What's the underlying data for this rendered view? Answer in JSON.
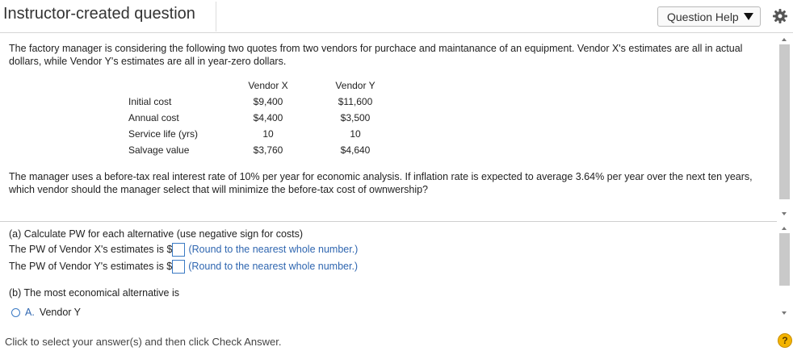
{
  "header": {
    "title": "Instructor-created question",
    "help_button_label": "Question Help"
  },
  "question": {
    "intro": "The factory manager is considering the following two quotes from two vendors for purchace and maintanance of an equipment. Vendor X's estimates are all in actual dollars, while Vendor Y's estimates are all in year-zero dollars.",
    "table": {
      "headers": [
        "Vendor X",
        "Vendor Y"
      ],
      "rows": [
        {
          "label": "Initial cost",
          "x": "$9,400",
          "y": "$11,600"
        },
        {
          "label": "Annual cost",
          "x": "$4,400",
          "y": "$3,500"
        },
        {
          "label": "Service life (yrs)",
          "x": "10",
          "y": "10"
        },
        {
          "label": "Salvage value",
          "x": "$3,760",
          "y": "$4,640"
        }
      ]
    },
    "body": "The manager uses a before-tax real interest rate of 10% per year for economic analysis. If inflation rate is expected to average 3.64% per year over the next ten years, which vendor should the manager select that will minimize the before-tax cost of ownwership?"
  },
  "answer_section": {
    "part_a_prompt": "(a) Calculate PW for each alternative (use negative sign for costs)",
    "pw_x_label": "The PW of Vendor X's estimates is $",
    "pw_x_value": "",
    "pw_y_label": "The PW of Vendor Y's estimates is $",
    "pw_y_value": "",
    "round_hint": "(Round to the nearest whole number.)",
    "part_b_prompt": "(b) The most economical alternative is",
    "option_a_letter": "A.",
    "option_a_label": "Vendor Y"
  },
  "footer": {
    "instruction": "Click to select your answer(s) and then click Check Answer.",
    "help_icon_glyph": "?"
  },
  "colors": {
    "accent_blue": "#2f66b0",
    "help_icon": "#f4b400"
  }
}
